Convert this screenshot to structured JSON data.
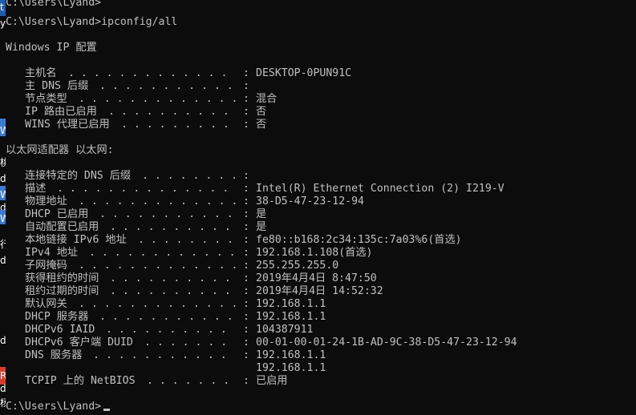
{
  "prompts": {
    "top_partial": "C:\\Users\\Lyand>",
    "command_line": "C:\\Users\\Lyand>ipconfig/all",
    "bottom": "C:\\Users\\Lyand>"
  },
  "header": "Windows IP 配置",
  "global_config": [
    {
      "label": "主机名",
      "value": "DESKTOP-0PUN91C"
    },
    {
      "label": "主 DNS 后缀",
      "value": ""
    },
    {
      "label": "节点类型",
      "value": "混合"
    },
    {
      "label": "IP 路由已启用",
      "value": "否"
    },
    {
      "label": "WINS 代理已启用",
      "value": "否"
    }
  ],
  "adapter_title": "以太网适配器 以太网:",
  "adapter_config": [
    {
      "label": "连接特定的 DNS 后缀",
      "value": ""
    },
    {
      "label": "描述",
      "value": "Intel(R) Ethernet Connection (2) I219-V"
    },
    {
      "label": "物理地址",
      "value": "38-D5-47-23-12-94"
    },
    {
      "label": "DHCP 已启用",
      "value": "是"
    },
    {
      "label": "自动配置已启用",
      "value": "是"
    },
    {
      "label": "本地链接 IPv6 地址",
      "value": "fe80::b168:2c34:135c:7a03%6(首选)"
    },
    {
      "label": "IPv4 地址",
      "value": "192.168.1.108(首选)"
    },
    {
      "label": "子网掩码",
      "value": "255.255.255.0"
    },
    {
      "label": "获得租约的时间",
      "value": "2019年4月4日 8:47:50"
    },
    {
      "label": "租约过期的时间",
      "value": "2019年4月4日 14:52:32"
    },
    {
      "label": "默认网关",
      "value": "192.168.1.1"
    },
    {
      "label": "DHCP 服务器",
      "value": "192.168.1.1"
    },
    {
      "label": "DHCPv6 IAID",
      "value": "104387911"
    },
    {
      "label": "DHCPv6 客户端 DUID",
      "value": "00-01-00-01-24-1B-AD-9C-38-D5-47-23-12-94"
    },
    {
      "label": "DNS 服务器",
      "value": "192.168.1.1"
    },
    {
      "label": "",
      "value": "192.168.1.1"
    },
    {
      "label": "TCPIP 上的 NetBIOS",
      "value": "已启用"
    }
  ],
  "left_strip": {
    "chars": [
      "t",
      "y",
      "W",
      "桃",
      "d",
      "W",
      "d",
      "W",
      "行",
      "d",
      "d",
      "R",
      "d",
      "杨"
    ],
    "colors": [
      "#1e5fb4",
      "#d83b2a",
      "#3a7bd5",
      "#ffffff"
    ]
  },
  "colors": {
    "background": "#0c0c0c",
    "foreground": "#c0c0c0"
  }
}
